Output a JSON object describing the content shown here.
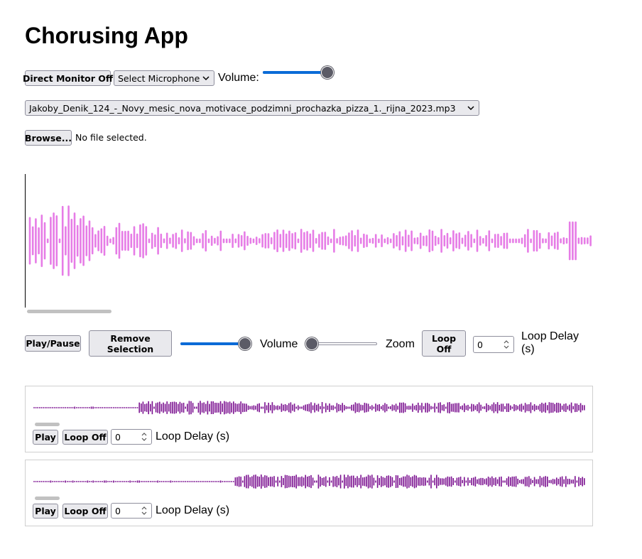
{
  "app": {
    "title": "Chorusing App"
  },
  "top_controls": {
    "direct_monitor_label": "Direct Monitor Off",
    "microphone_select": "Select Microphone",
    "volume_label": "Volume:",
    "volume_level": 1.0
  },
  "file_select": {
    "value": "Jakoby_Denik_124_-_Novy_mesic_nova_motivace_podzimni_prochazka_pizza_1._rijna_2023.mp3"
  },
  "file_input": {
    "browse_label": "Browse...",
    "status": "No file selected."
  },
  "main_waveform": {
    "color": "#e67ce6"
  },
  "player_controls": {
    "play_pause_label": "Play/Pause",
    "remove_selection_label": "Remove Selection",
    "volume_label": "Volume",
    "volume_level": 1.0,
    "zoom_label": "Zoom",
    "zoom_level": 0.0,
    "loop_label": "Loop Off",
    "loop_delay_value": "0",
    "loop_delay_label": "Loop Delay (s)"
  },
  "recordings": [
    {
      "color": "#7a0f8f",
      "play_label": "Play",
      "loop_label": "Loop Off",
      "loop_delay_value": "0",
      "loop_delay_label": "Loop Delay (s)"
    },
    {
      "color": "#7a0f8f",
      "play_label": "Play",
      "loop_label": "Loop Off",
      "loop_delay_value": "0",
      "loop_delay_label": "Loop Delay (s)"
    }
  ]
}
